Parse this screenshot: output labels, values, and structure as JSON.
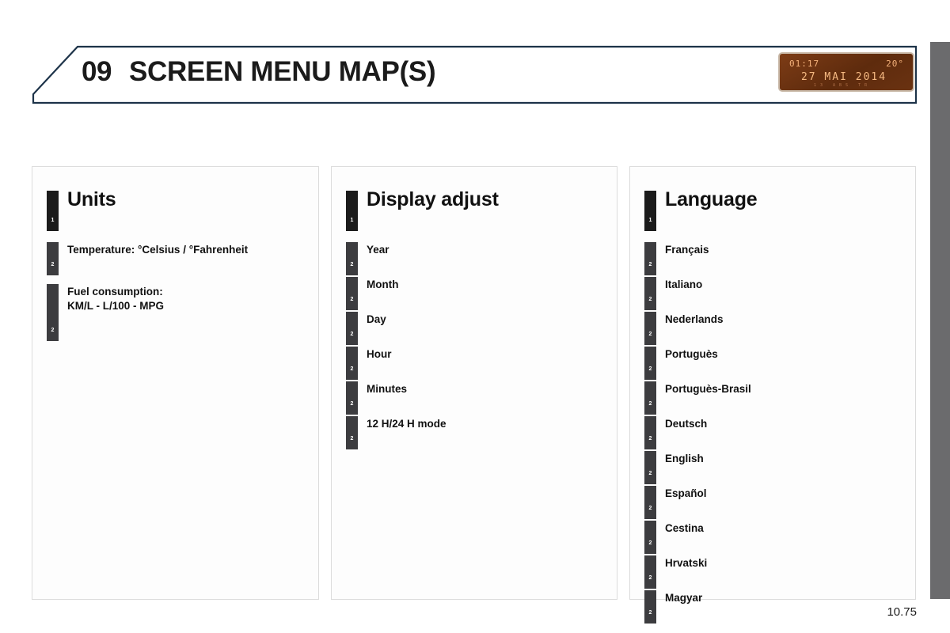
{
  "header": {
    "chapter_number": "09",
    "chapter_title": "SCREEN MENU MAP(S)"
  },
  "display_graphic": {
    "clock": "01:17",
    "temperature": "20°",
    "date": "27 MAI 2014",
    "sub_indicators": "13    ABS  TR"
  },
  "panels": [
    {
      "id": "units",
      "title": "Units",
      "title_marker": "1",
      "items": [
        {
          "marker": "2",
          "label": "Temperature: °Celsius / °Fahrenheit",
          "tall": false
        },
        {
          "marker": "2",
          "label": "Fuel consumption:\nKM/L - L/100 - MPG",
          "tall": true
        }
      ]
    },
    {
      "id": "display-adjust",
      "title": "Display adjust",
      "title_marker": "1",
      "items": [
        {
          "marker": "2",
          "label": "Year",
          "tall": false
        },
        {
          "marker": "2",
          "label": "Month",
          "tall": false
        },
        {
          "marker": "2",
          "label": "Day",
          "tall": false
        },
        {
          "marker": "2",
          "label": "Hour",
          "tall": false
        },
        {
          "marker": "2",
          "label": "Minutes",
          "tall": false
        },
        {
          "marker": "2",
          "label": "12 H/24 H mode",
          "tall": false
        }
      ]
    },
    {
      "id": "language",
      "title": "Language",
      "title_marker": "1",
      "items": [
        {
          "marker": "2",
          "label": "Français",
          "tall": false
        },
        {
          "marker": "2",
          "label": "Italiano",
          "tall": false
        },
        {
          "marker": "2",
          "label": "Nederlands",
          "tall": false
        },
        {
          "marker": "2",
          "label": "Portuguès",
          "tall": false
        },
        {
          "marker": "2",
          "label": "Portuguès-Brasil",
          "tall": false
        },
        {
          "marker": "2",
          "label": "Deutsch",
          "tall": false
        },
        {
          "marker": "2",
          "label": "English",
          "tall": false
        },
        {
          "marker": "2",
          "label": "Español",
          "tall": false
        },
        {
          "marker": "2",
          "label": "Cestina",
          "tall": false
        },
        {
          "marker": "2",
          "label": "Hrvatski",
          "tall": false
        },
        {
          "marker": "2",
          "label": "Magyar",
          "tall": false
        }
      ]
    }
  ],
  "footer": {
    "page_number": "10.75"
  },
  "colors": {
    "header_border": "#1d3349",
    "header_accent": "#a8c0d6",
    "panel_border": "#dcdcdc",
    "marker_level1": "#1b1b1b",
    "marker_level2": "#3c3c3f",
    "edge_tab": "#6b6b6d",
    "display_amber": "#f3b07a",
    "display_body": "#6d3310"
  }
}
